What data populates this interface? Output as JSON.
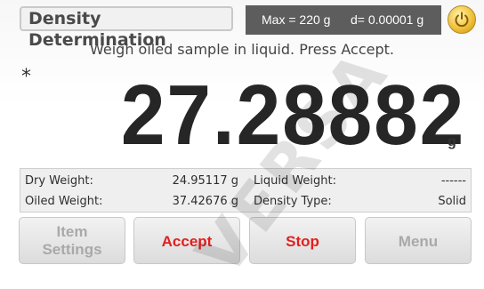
{
  "header": {
    "title": "Density Determination",
    "capacity_max": "Max = 220 g",
    "capacity_d": "d= 0.00001 g",
    "power_icon": "power-icon"
  },
  "main": {
    "instruction": "Weigh oiled sample in liquid. Press Accept.",
    "stable_marker": "*",
    "reading": "27.28882",
    "unit": "g"
  },
  "info": {
    "dry_weight_label": "Dry Weight:",
    "dry_weight_value": "24.95117 g",
    "oiled_weight_label": "Oiled Weight:",
    "oiled_weight_value": "37.42676 g",
    "liquid_weight_label": "Liquid Weight:",
    "liquid_weight_value": "------",
    "density_type_label": "Density Type:",
    "density_type_value": "Solid"
  },
  "buttons": {
    "item_settings_line1": "Item",
    "item_settings_line2": "Settings",
    "accept": "Accept",
    "stop": "Stop",
    "menu": "Menu"
  },
  "watermark": "VERSA",
  "colors": {
    "accent_red": "#e0201e",
    "header_bar": "#5d5d5d",
    "power_gold": "#f0c23a"
  }
}
